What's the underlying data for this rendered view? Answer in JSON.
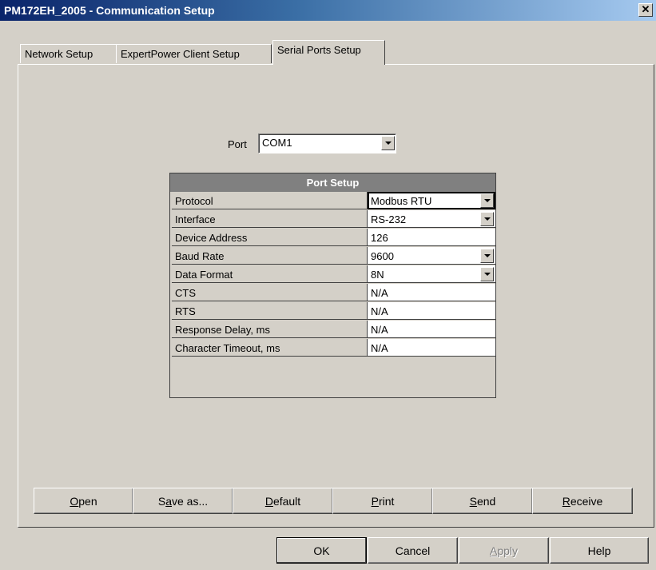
{
  "window": {
    "title": "PM172EH_2005 - Communication Setup",
    "close_glyph": "✕"
  },
  "tabs": [
    {
      "label": "Network Setup"
    },
    {
      "label": "ExpertPower Client Setup"
    },
    {
      "label": "Serial Ports Setup"
    }
  ],
  "port": {
    "label": "Port",
    "value": "COM1"
  },
  "port_setup": {
    "header": "Port Setup",
    "rows": [
      {
        "label": "Protocol",
        "value": "Modbus RTU"
      },
      {
        "label": "Interface",
        "value": "RS-232"
      },
      {
        "label": "Device Address",
        "value": "126"
      },
      {
        "label": "Baud Rate",
        "value": "9600"
      },
      {
        "label": "Data Format",
        "value": "8N"
      },
      {
        "label": "CTS",
        "value": "N/A"
      },
      {
        "label": "RTS",
        "value": "N/A"
      },
      {
        "label": "Response Delay, ms",
        "value": "N/A"
      },
      {
        "label": "Character Timeout, ms",
        "value": "N/A"
      }
    ]
  },
  "actions": {
    "open": {
      "mnemonic": "O",
      "rest": "pen"
    },
    "save_as": {
      "pre": "S",
      "mnemonic": "a",
      "rest": "ve as..."
    },
    "default": {
      "mnemonic": "D",
      "rest": "efault"
    },
    "print": {
      "mnemonic": "P",
      "rest": "rint"
    },
    "send": {
      "mnemonic": "S",
      "rest": "end"
    },
    "receive": {
      "mnemonic": "R",
      "rest": "eceive"
    }
  },
  "dialog_buttons": {
    "ok": "OK",
    "cancel": "Cancel",
    "apply": {
      "mnemonic": "A",
      "rest": "pply"
    },
    "help": "Help"
  },
  "colors": {
    "title_start": "#0a246a",
    "title_end": "#a6caf0",
    "face": "#d4d0c8",
    "grid_header": "#808080"
  }
}
